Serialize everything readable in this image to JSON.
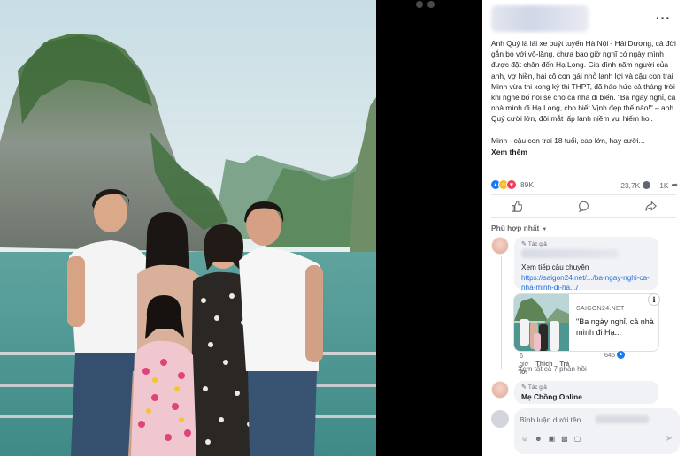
{
  "post": {
    "paragraphs": [
      "Anh Quý là lái xe buýt tuyến Hà Nội - Hải Dương, cả đời gắn bó với vô-lăng, chưa bao giờ nghĩ có ngày mình được đặt chân đến Hạ Long. Gia đình năm người của anh, vợ hiền, hai cô con gái nhỏ lanh lợi và cậu con trai Minh vừa thi xong kỳ thi THPT, đã háo hức cả tháng trời khi nghe bố nói sẽ cho cả nhà đi biển. \"Ba ngày nghỉ, cả nhà mình đi Hạ Long, cho biết Vịnh đẹp thế nào!\" – anh Quý cười lớn, đôi mắt lấp lánh niềm vui hiếm hoi.",
      "Minh - cậu con trai 18 tuổi, cao lớn, hay cười..."
    ],
    "see_more": "Xem thêm",
    "reaction_count": "89K",
    "comment_count": "23,7K",
    "share_count": "1K",
    "more_menu": "···"
  },
  "comments": {
    "sort_label": "Phù hợp nhất",
    "first": {
      "author_badge": "Tác giả",
      "text": "Xem tiếp câu chuyện",
      "link": "https://saigon24.net/.../ba-ngay-nghi-ca-nha-minh-di-ha.../",
      "preview_domain": "SAIGON24.NET",
      "preview_title": "\"Ba ngày nghỉ, cả nhà mình đi Hạ...",
      "time": "6 giờ",
      "like": "Thích",
      "reply": "Trả lời",
      "likes": "645",
      "info": "i"
    },
    "see_replies": "Xem tất cả 7 phản hồi",
    "second": {
      "author_badge": "Tác giả",
      "name": "Mẹ Chồng Online"
    },
    "input_placeholder": "Bình luận dưới tên"
  },
  "colors": {
    "link": "#216fdb",
    "like": "#1877f2",
    "muted": "#65676b"
  }
}
